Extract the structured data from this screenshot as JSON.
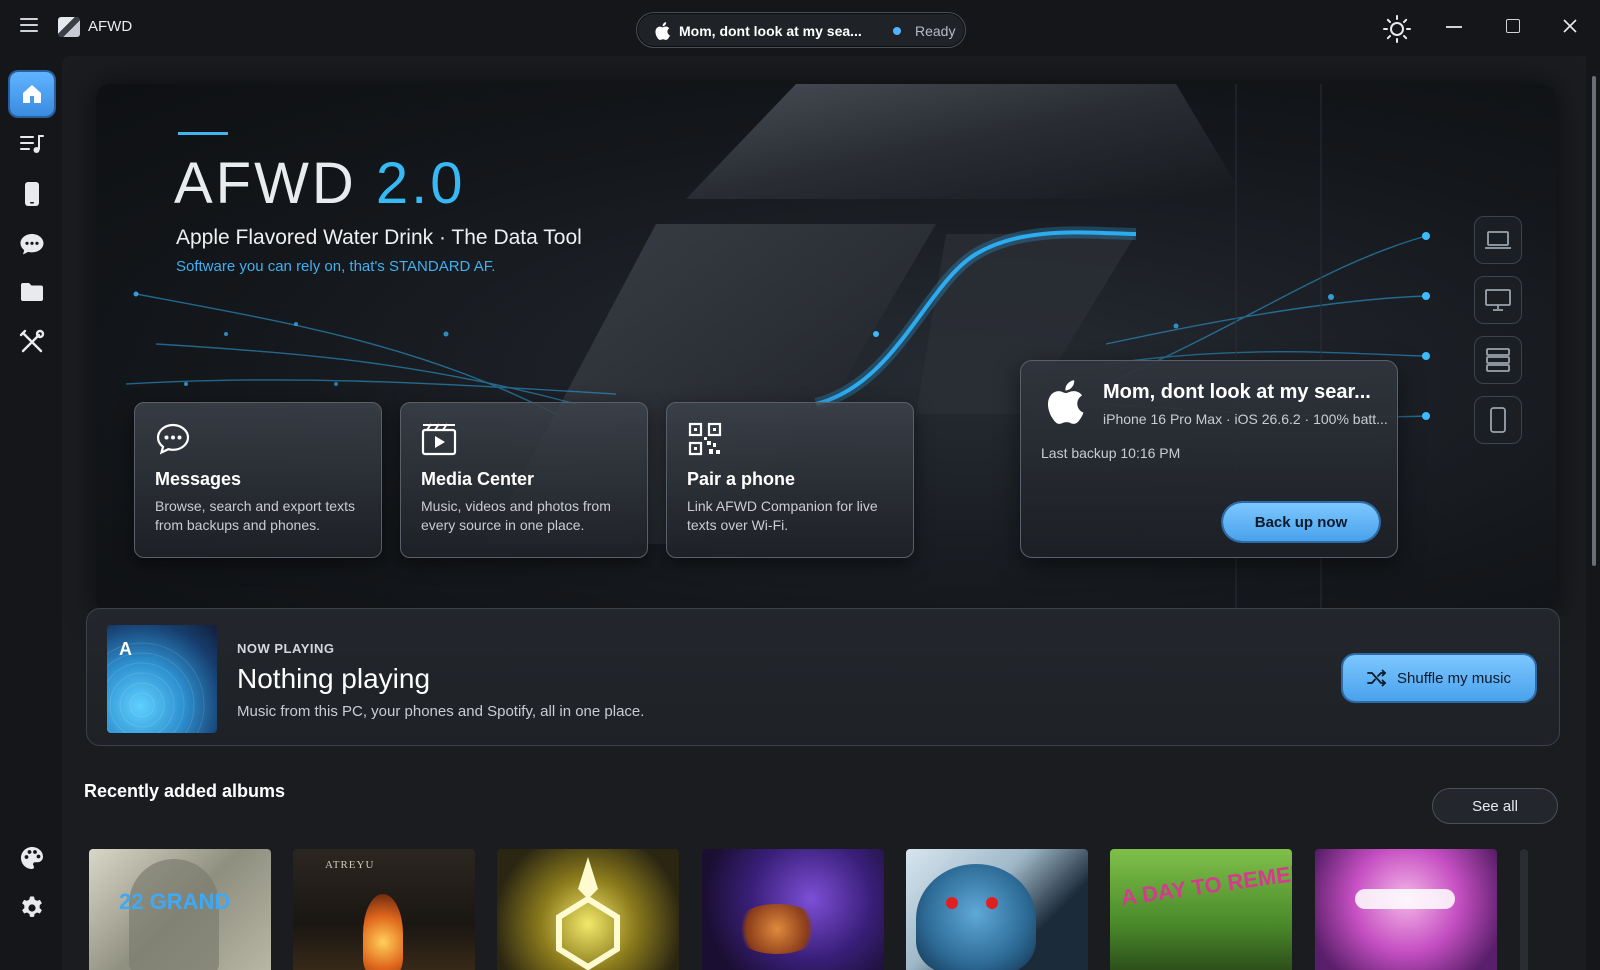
{
  "window": {
    "app_name": "AFWD",
    "device_pill": {
      "name": "Mom, dont look at my sea...",
      "status": "Ready"
    }
  },
  "sidebar": {
    "items": [
      {
        "icon": "home-icon",
        "active": true
      },
      {
        "icon": "music-queue-icon",
        "active": false
      },
      {
        "icon": "phone-icon",
        "active": false
      },
      {
        "icon": "chat-icon",
        "active": false
      },
      {
        "icon": "folder-icon",
        "active": false
      },
      {
        "icon": "tools-icon",
        "active": false
      },
      {
        "icon": "palette-icon",
        "active": false
      },
      {
        "icon": "gear-icon",
        "active": false
      }
    ]
  },
  "hero": {
    "title": "AFWD",
    "version": "2.0",
    "subtitle": "Apple Flavored Water Drink · The Data Tool",
    "tagline": "Software you can rely on, that's STANDARD AF.",
    "cards": [
      {
        "icon": "chat-bubble-icon",
        "title": "Messages",
        "description": "Browse, search and export texts from backups and phones."
      },
      {
        "icon": "media-play-icon",
        "title": "Media Center",
        "description": "Music, videos and photos from every source in one place."
      },
      {
        "icon": "qr-code-icon",
        "title": "Pair a phone",
        "description": "Link AFWD Companion for live texts over Wi-Fi."
      }
    ],
    "device": {
      "name": "Mom, dont look at my sear...",
      "info": "iPhone 16 Pro Max · iOS 26.6.2 · 100% batt...",
      "last_backup": "Last backup 10:16 PM",
      "button": "Back up now"
    },
    "side_devices": [
      "laptop-icon",
      "monitor-icon",
      "server-icon",
      "phone-icon"
    ]
  },
  "now_playing": {
    "label": "NOW PLAYING",
    "art_letter": "A",
    "title": "Nothing playing",
    "subtitle": "Music from this PC, your phones and Spotify, all in one place.",
    "button": "Shuffle my music"
  },
  "albums": {
    "title": "Recently added albums",
    "see_all": "See all",
    "covers": [
      {
        "text": "22 GRAND"
      },
      {
        "text": "ATREYU"
      },
      {
        "text": ""
      },
      {
        "text": ""
      },
      {
        "text": ""
      },
      {
        "text": "A DAY TO REMEMBER"
      },
      {
        "text": ""
      }
    ]
  },
  "colors": {
    "accent": "#3fb5f2",
    "button": "#5db0f5",
    "background": "#141619"
  }
}
